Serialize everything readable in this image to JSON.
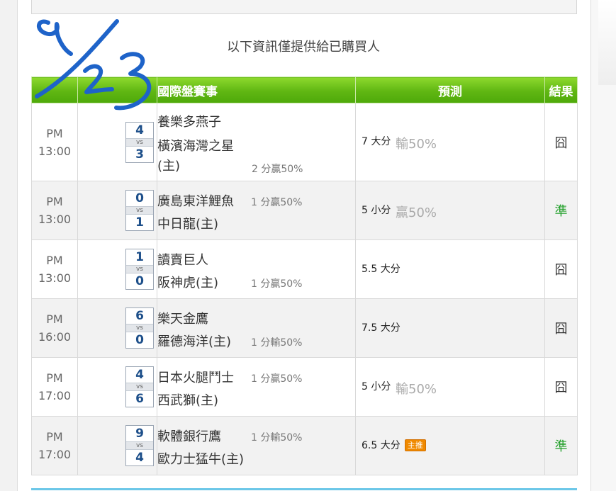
{
  "notice": "以下資訊僅提供給已購買人",
  "headers": {
    "event": "國際盤賽事",
    "prediction": "預測",
    "result": "結果"
  },
  "rows": [
    {
      "ampm": "PM",
      "time": "13:00",
      "away_score": "4",
      "home_score": "3",
      "vs": "vs",
      "away_team": "養樂多燕子",
      "home_team_line1": "橫濱海灣之星",
      "home_team_line2": "(主)",
      "handicap": "2 分贏50%",
      "handicap_pos": "home",
      "prediction": "7 大分",
      "pred_result": "輸50%",
      "badge": "",
      "result": "囧",
      "result_type": "lose"
    },
    {
      "ampm": "PM",
      "time": "13:00",
      "away_score": "0",
      "home_score": "1",
      "vs": "vs",
      "away_team": "廣島東洋鯉魚",
      "home_team_line1": "中日龍(主)",
      "home_team_line2": "",
      "handicap": "1 分贏50%",
      "handicap_pos": "away",
      "prediction": "5 小分",
      "pred_result": "贏50%",
      "badge": "",
      "result": "準",
      "result_type": "win"
    },
    {
      "ampm": "PM",
      "time": "13:00",
      "away_score": "1",
      "home_score": "0",
      "vs": "vs",
      "away_team": "讀賣巨人",
      "home_team_line1": "阪神虎(主)",
      "home_team_line2": "",
      "handicap": "1 分贏50%",
      "handicap_pos": "home",
      "prediction": "5.5 大分",
      "pred_result": "",
      "badge": "",
      "result": "囧",
      "result_type": "lose"
    },
    {
      "ampm": "PM",
      "time": "16:00",
      "away_score": "6",
      "home_score": "0",
      "vs": "vs",
      "away_team": "樂天金鷹",
      "home_team_line1": "羅德海洋(主)",
      "home_team_line2": "",
      "handicap": "1 分輸50%",
      "handicap_pos": "home",
      "prediction": "7.5 大分",
      "pred_result": "",
      "badge": "",
      "result": "囧",
      "result_type": "lose"
    },
    {
      "ampm": "PM",
      "time": "17:00",
      "away_score": "4",
      "home_score": "6",
      "vs": "vs",
      "away_team": "日本火腿鬥士",
      "home_team_line1": "西武獅(主)",
      "home_team_line2": "",
      "handicap": "1 分贏50%",
      "handicap_pos": "away",
      "prediction": "5 小分",
      "pred_result": "輸50%",
      "badge": "",
      "result": "囧",
      "result_type": "lose"
    },
    {
      "ampm": "PM",
      "time": "17:00",
      "away_score": "9",
      "home_score": "4",
      "vs": "vs",
      "away_team": "軟體銀行鷹",
      "home_team_line1": "歐力士猛牛(主)",
      "home_team_line2": "",
      "handicap": "1 分輸50%",
      "handicap_pos": "away",
      "prediction": "6.5 大分",
      "pred_result": "",
      "badge": "主推",
      "result": "準",
      "result_type": "win"
    }
  ],
  "colors": {
    "header_green": "#5fb612",
    "score_blue": "#1d4f8a",
    "win_green": "#22a02a",
    "badge_orange": "#f08a00"
  },
  "annotation": {
    "icon": "handwritten-date-scribble"
  }
}
